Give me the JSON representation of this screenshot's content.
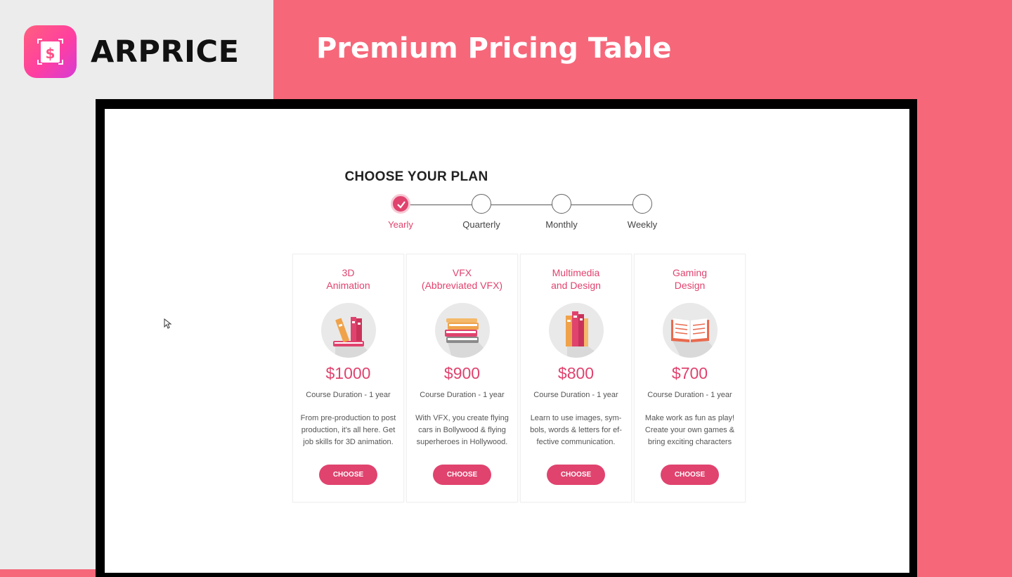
{
  "brand": {
    "name": "ARPRICE",
    "logo_icon": "dollar-sign-icon"
  },
  "banner": {
    "title": "Premium Pricing Table"
  },
  "plan_selector": {
    "title": "CHOOSE YOUR PLAN",
    "steps": [
      {
        "label": "Yearly",
        "active": true
      },
      {
        "label": "Quarterly",
        "active": false
      },
      {
        "label": "Monthly",
        "active": false
      },
      {
        "label": "Weekly",
        "active": false
      }
    ]
  },
  "cards": [
    {
      "title": "3D\nAnimation",
      "icon": "books-icon",
      "price": "$1000",
      "duration": "Course Duration - 1 year",
      "description": "From pre-production to post production, it's all here. Get job skills for 3D animation.",
      "button": "CHOOSE"
    },
    {
      "title": "VFX\n(Abbreviated VFX)",
      "icon": "stacked-books-icon",
      "price": "$900",
      "duration": "Course Duration - 1 year",
      "description": "With VFX, you create flying cars in Bollywood & flying superheroes in Hollywood.",
      "button": "CHOOSE"
    },
    {
      "title": "Multimedia\nand Design",
      "icon": "binders-icon",
      "price": "$800",
      "duration": "Course Duration - 1 year",
      "description": "Learn to use images, sym-bols, words & letters for ef-fective communication.",
      "button": "CHOOSE"
    },
    {
      "title": "Gaming\nDesign",
      "icon": "open-book-icon",
      "price": "$700",
      "duration": "Course Duration - 1 year",
      "description": "Make work as fun as play! Create your own games & bring exciting characters",
      "button": "CHOOSE"
    }
  ],
  "colors": {
    "accent": "#e0436e",
    "banner": "#f6677a",
    "left_panel": "#ececec"
  }
}
